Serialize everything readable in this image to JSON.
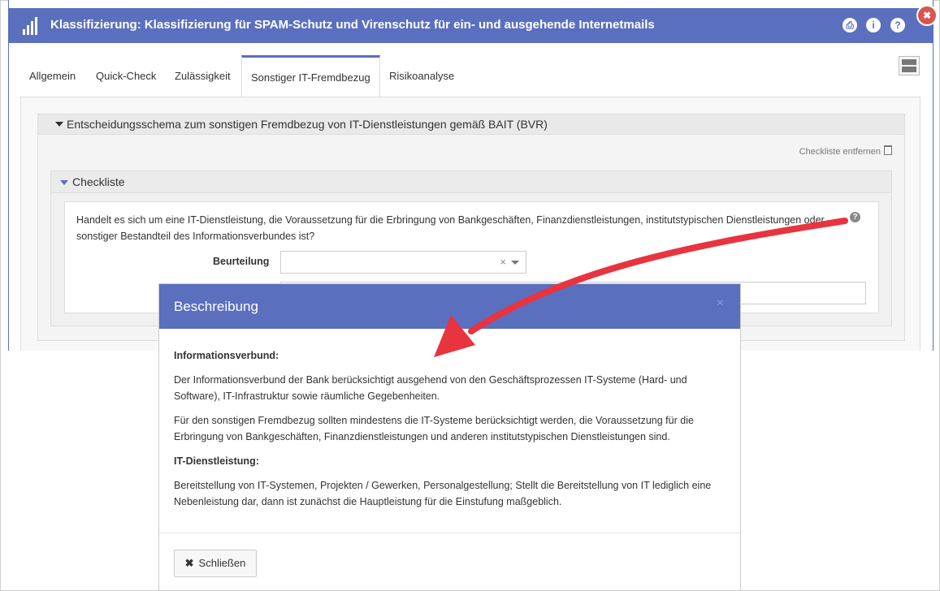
{
  "window": {
    "title": "Klassifizierung: Klassifizierung für SPAM-Schutz und Virenschutz für ein- und ausgehende Internetmails",
    "buttons": {
      "pdf": "⎙",
      "info": "i",
      "help": "?"
    },
    "close": "✖"
  },
  "tabs": [
    {
      "label": "Allgemein"
    },
    {
      "label": "Quick-Check"
    },
    {
      "label": "Zulässigkeit"
    },
    {
      "label": "Sonstiger IT-Fremdbezug"
    },
    {
      "label": "Risikoanalyse"
    }
  ],
  "section": {
    "title": "Entscheidungsschema zum sonstigen Fremdbezug von IT-Dienstleistungen gemäß BAIT (BVR)",
    "remove_label": "Checkliste entfernen"
  },
  "checklist": {
    "title": "Checkliste",
    "question": "Handelt es sich um eine IT-Dienstleistung, die Voraussetzung für die Erbringung von Bankgeschäften, Finanzdienstleistungen, institutstypischen Dienstleistungen oder sonstiger Bestandteil des Informationsverbundes ist?",
    "help": "?",
    "rating_label": "Beurteilung",
    "rating_value": "",
    "clear": "×"
  },
  "modal": {
    "title": "Beschreibung",
    "close_x": "×",
    "heading1": "Informationsverbund:",
    "para1": "Der Informationsverbund der Bank berücksichtigt ausgehend von den Geschäftsprozessen IT-Systeme (Hard- und Software), IT-Infrastruktur sowie räumliche Gegebenheiten.",
    "para2": "Für den sonstigen Fremdbezug sollten mindestens die IT-Systeme berücksichtigt werden, die Voraussetzung für die Erbringung von Bankgeschäften, Finanzdienstleistungen und anderen institutstypischen Dienstleistungen sind.",
    "heading2": "IT-Dienstleistung:",
    "para3": "Bereitstellung von IT-Systemen, Projekten / Gewerken, Personalgestellung; Stellt die Bereitstellung von IT lediglich eine Nebenleistung dar, dann ist zunächst die Hauptleistung für die Einstufung maßgeblich.",
    "close_button": "Schließen",
    "close_glyph": "✖"
  },
  "colors": {
    "accent": "#5b6fbf",
    "arrow": "#e8343f",
    "danger": "#d9534f"
  }
}
